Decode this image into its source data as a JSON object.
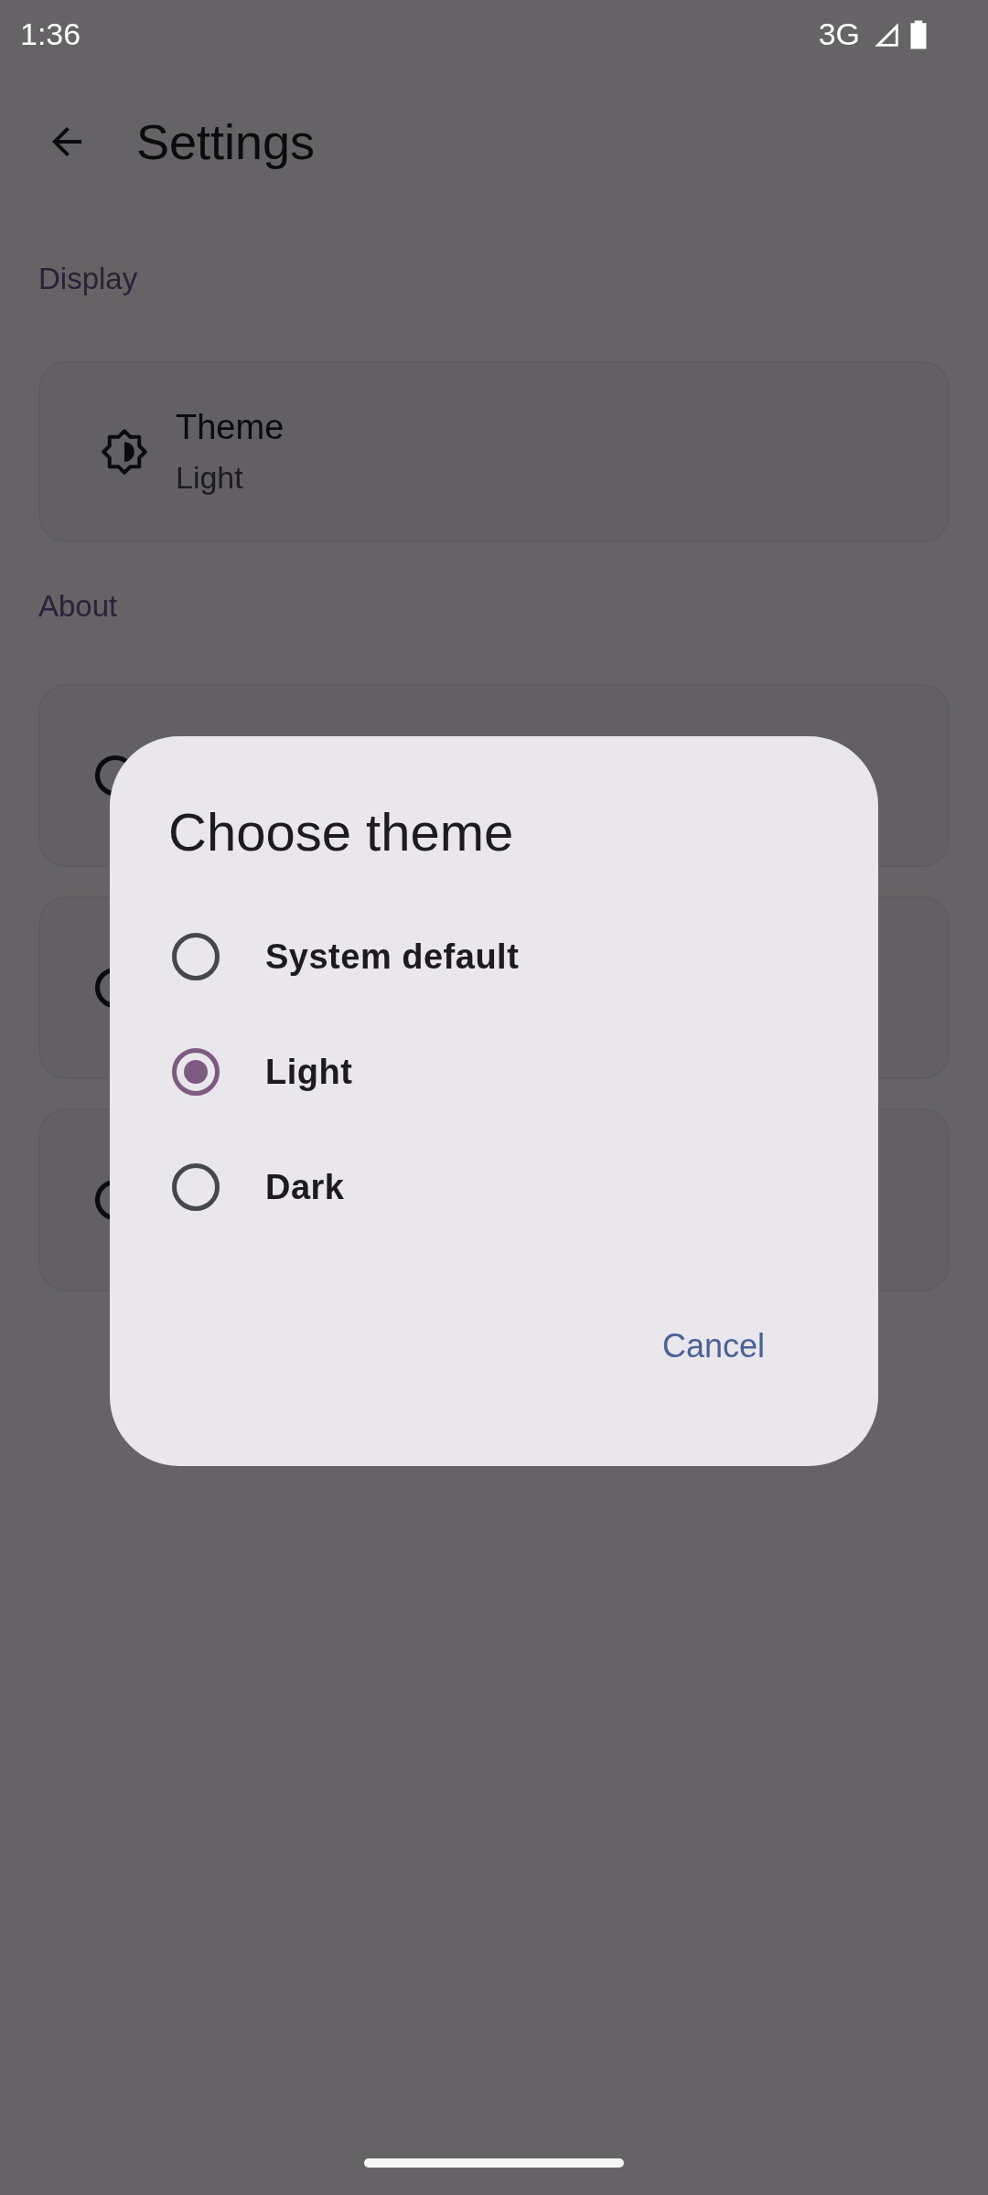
{
  "status_bar": {
    "time": "1:36",
    "network": "3G"
  },
  "top_bar": {
    "title": "Settings"
  },
  "sections": [
    {
      "header": "Display",
      "items": [
        {
          "kind": "setting",
          "title": "Theme",
          "subtitle": "Light"
        }
      ]
    },
    {
      "header": "About",
      "items": [
        {
          "kind": "covered"
        },
        {
          "kind": "covered"
        },
        {
          "kind": "covered"
        }
      ]
    }
  ],
  "dialog": {
    "title": "Choose theme",
    "options": [
      {
        "label": "System default",
        "selected": false
      },
      {
        "label": "Light",
        "selected": true
      },
      {
        "label": "Dark",
        "selected": false
      }
    ],
    "buttons": [
      {
        "label": "Cancel"
      }
    ]
  }
}
